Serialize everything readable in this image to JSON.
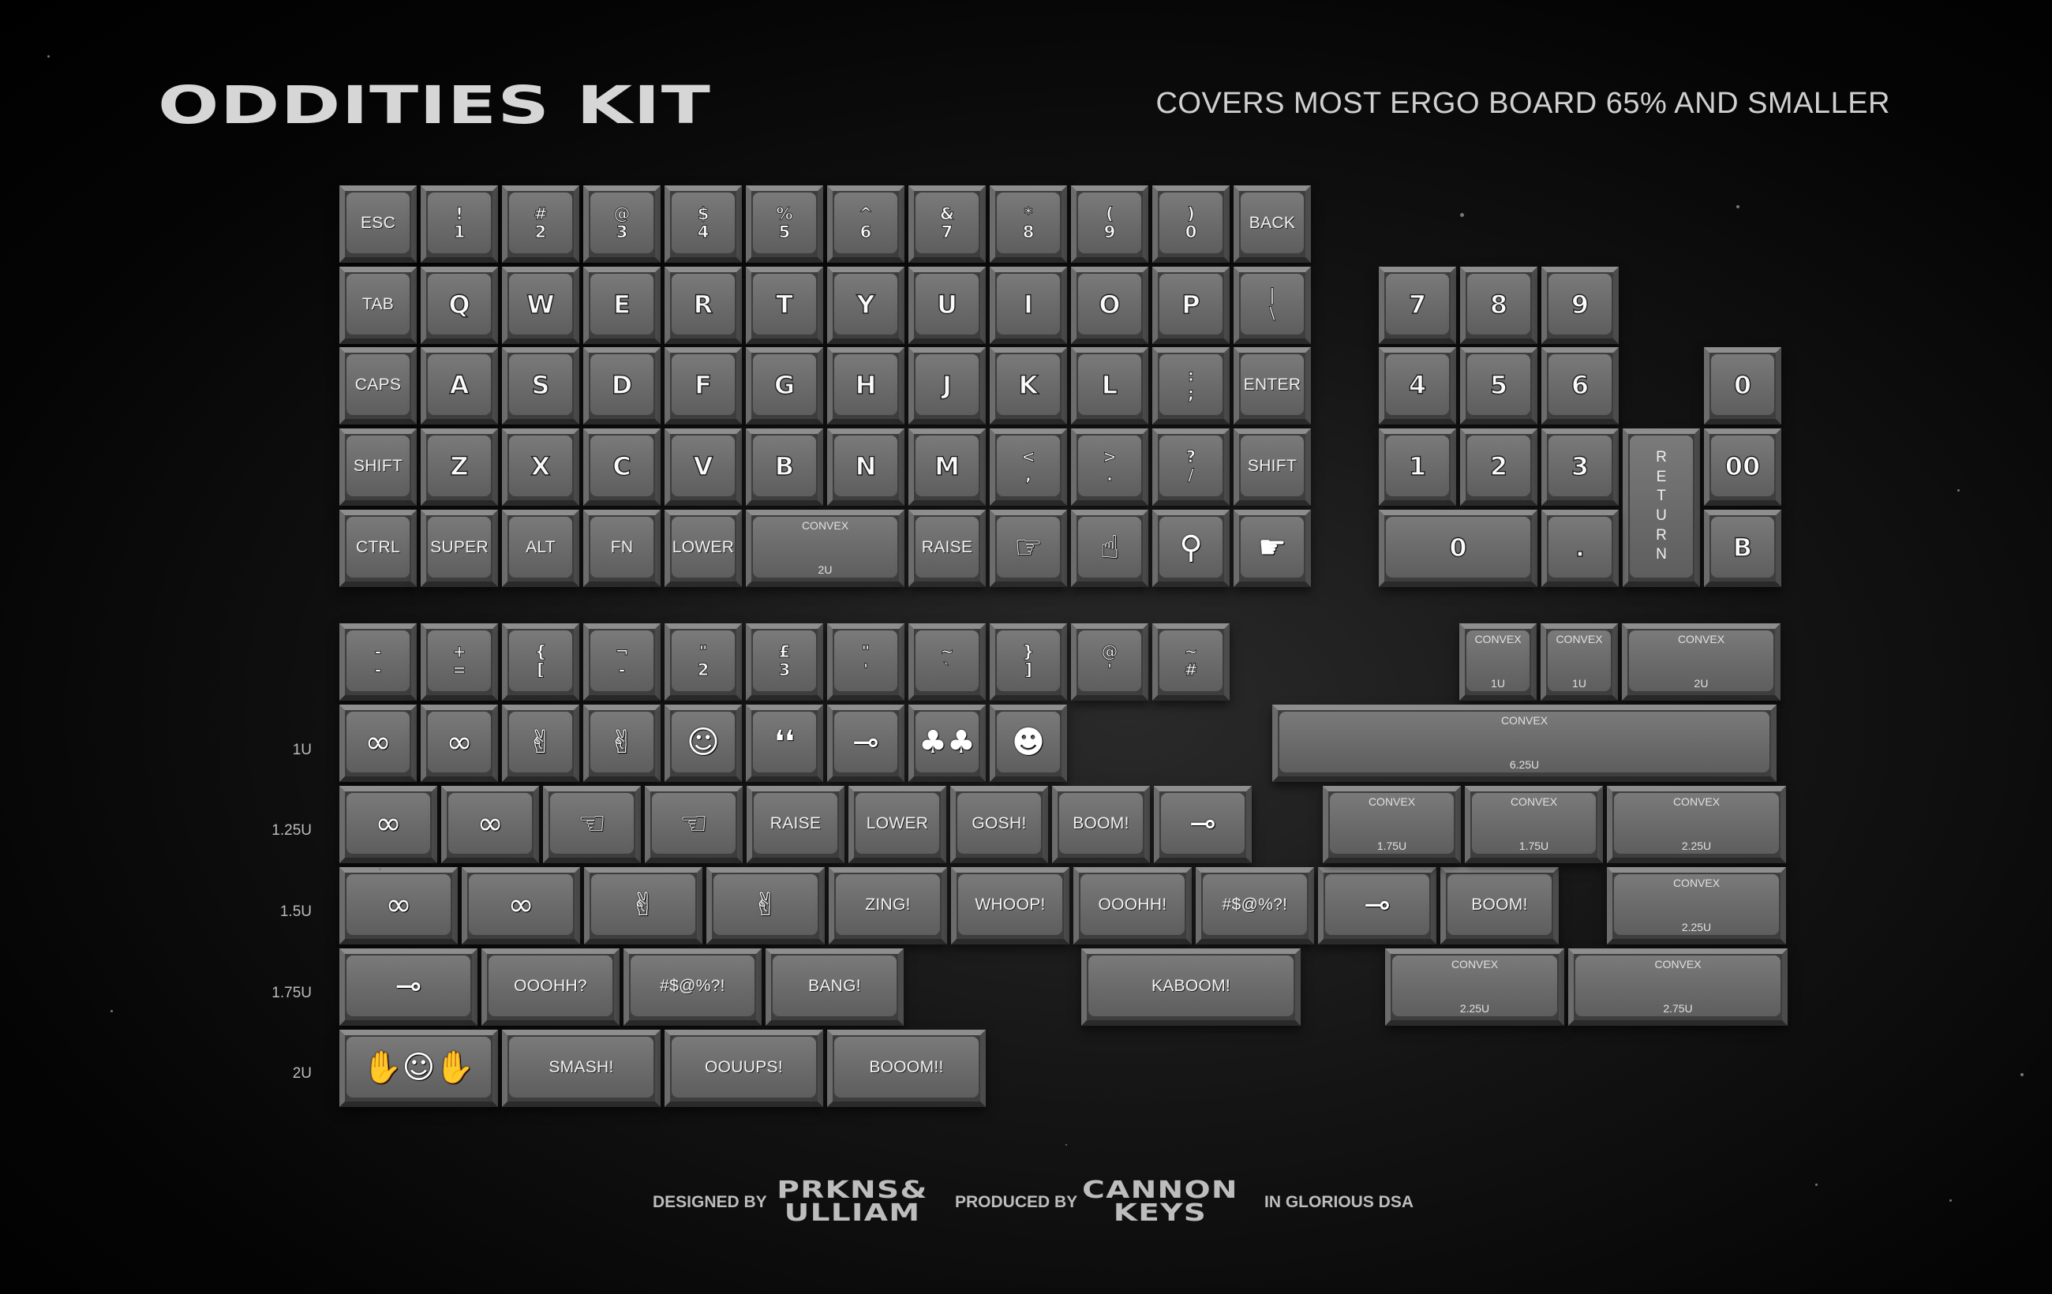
{
  "header": {
    "title": "ODDITIES KIT",
    "subtitle": "COVERS MOST ERGO BOARD 65% AND SMALLER"
  },
  "row_labels": [
    "1U",
    "1.25U",
    "1.5U",
    "1.75U",
    "2U"
  ],
  "footer": {
    "designed_by": "DESIGNED BY",
    "designer_logo": "PRKNS& ULLIAM",
    "produced_by": "PRODUCED BY",
    "producer_logo": "CANNON KEYS",
    "material": "IN GLORIOUS DSA"
  },
  "legends": {
    "esc": "ESC",
    "back": "BACK",
    "tab": "TAB",
    "caps": "CAPS",
    "enter": "ENTER",
    "shift": "SHIFT",
    "ctrl": "CTRL",
    "super": "SUPER",
    "alt": "ALT",
    "fn": "FN",
    "lower": "LOWER",
    "raise": "RAISE",
    "convex": "CONVEX",
    "n1": "! 1",
    "n2": "# 2",
    "n3": "@ 3",
    "n4": "$ 4",
    "n5": "% 5",
    "n6": "^ 6",
    "n7": "& 7",
    "n8": "* 8",
    "n9": "( 9",
    "n0": ") 0",
    "q": "Q",
    "w": "W",
    "e": "E",
    "r": "R",
    "t": "T",
    "y": "Y",
    "u": "U",
    "i": "I",
    "o": "O",
    "p": "P",
    "pipe": "| \\",
    "a": "A",
    "s": "S",
    "d": "D",
    "f": "F",
    "g": "G",
    "h": "H",
    "j": "J",
    "k": "K",
    "l": "L",
    "semi": ": ;",
    "z": "Z",
    "x": "X",
    "c": "C",
    "v": "V",
    "b": "B",
    "nn": "N",
    "m": "M",
    "comma": "< ,",
    "period": "> .",
    "slash": "? /",
    "np7": "7",
    "np8": "8",
    "np9": "9",
    "np4": "4",
    "np5": "5",
    "np6": "6",
    "np1": "1",
    "np2": "2",
    "np3": "3",
    "np0": "0",
    "npdot": ".",
    "np00": "00",
    "npB": "B",
    "npRet": "RETURN",
    "s_minus": "- -",
    "s_plus": "+ =",
    "s_brace": "{ [",
    "s_not": "¬ -",
    "s_quote": "\" 2",
    "s_pound": "£ 3",
    "s_dq": "\" '",
    "s_tilde": "~ `",
    "s_close": "} ]",
    "s_at": "@ '",
    "s_hash": "~ #",
    "u_1u": "1U",
    "u_2u": "2U",
    "u_625": "6.25U",
    "u_175": "1.75U",
    "u_225": "2.25U",
    "u_275": "2.75U",
    "raise_w": "RAISE",
    "lower_w": "LOWER",
    "gosh": "GOSH!",
    "boom": "BOOM!",
    "zing": "ZING!",
    "whoop": "WHOOP!",
    "ooohh": "OOOHH!",
    "grawlix": "#$@%?!",
    "oooh_q": "OOOHH?",
    "bang": "BANG!",
    "kaboom": "KABOOM!",
    "smash": "SMASH!",
    "ooups": "OOUUPS!",
    "booom": "BOOOM!!"
  },
  "icons": {
    "point_right": "☞",
    "point_up": "☝",
    "mushroom": "⚲",
    "finger_gun": "☛",
    "knot": "∞",
    "rock": "✌",
    "peace": "✌",
    "face": "☺",
    "eyes": "❛❛",
    "cannon": "⊸",
    "feet": "♣♣",
    "old_face": "☻",
    "pistol": "☜",
    "shocked": "✋☺✋"
  },
  "colors": {
    "background": "#000000",
    "key_face": "#6e6e6e",
    "legend": "#f2f2f2"
  }
}
